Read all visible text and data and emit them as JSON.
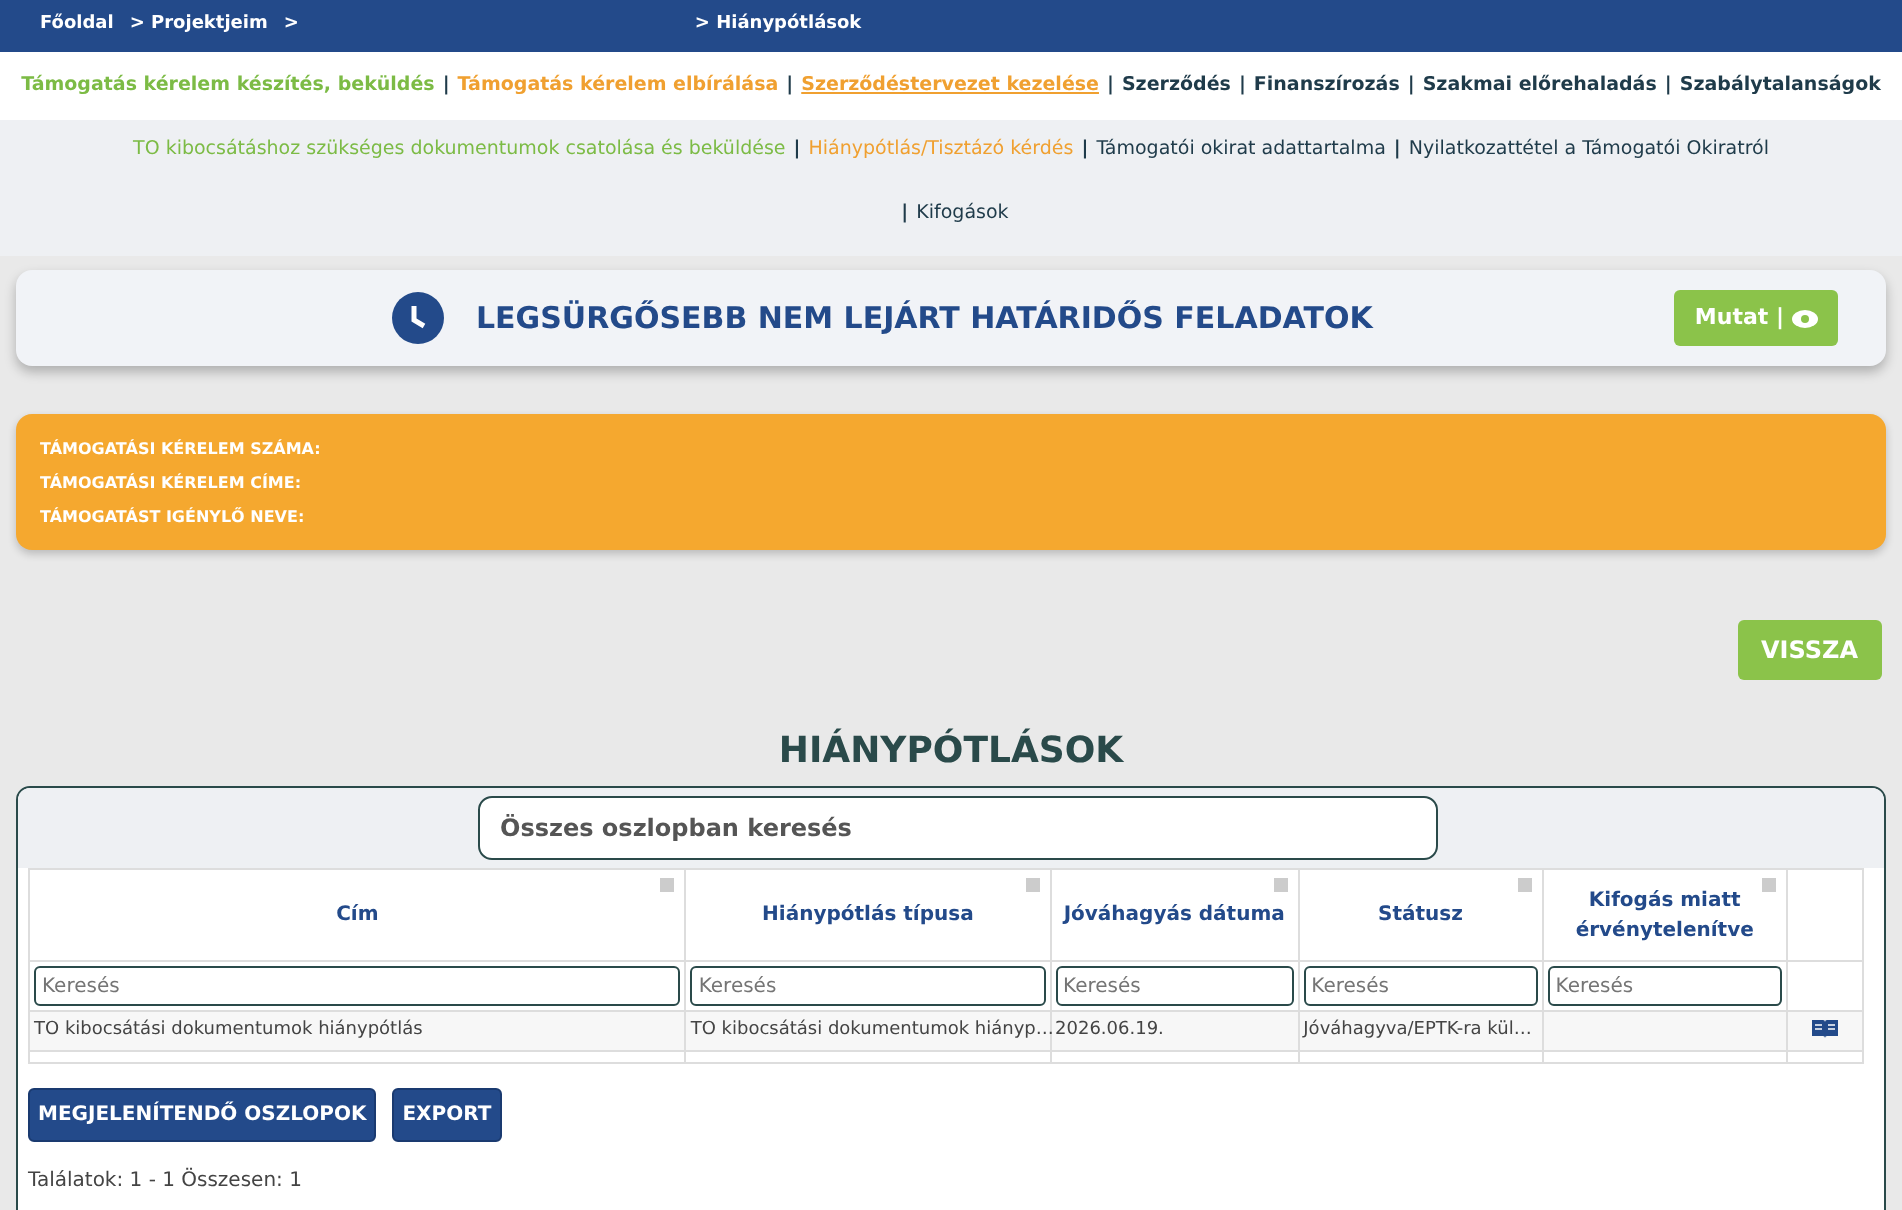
{
  "breadcrumb": [
    {
      "label": "Főoldal"
    },
    {
      "label": "> Projektjeim"
    },
    {
      "label": ">"
    },
    {
      "label": "> Hiánypótlások"
    }
  ],
  "main_nav": [
    {
      "label": "Támogatás kérelem készítés, beküldés",
      "color": "#7cbb45",
      "selected": false
    },
    {
      "separator": "|",
      "label": "Támogatás kérelem elbírálása",
      "color": "#f0a030",
      "selected": false
    },
    {
      "separator": "|",
      "label": "Szerződéstervezet kezelése",
      "color": "#f0a030",
      "selected": true
    },
    {
      "separator": "|",
      "label": "Szerződés",
      "color": "#1f3b4a",
      "selected": false
    },
    {
      "separator": "|",
      "label": "Finanszírozás",
      "color": "#1f3b4a",
      "selected": false
    },
    {
      "separator": "|",
      "label": "Szakmai előrehaladás",
      "color": "#1f3b4a",
      "selected": false
    },
    {
      "separator": "|",
      "label": "Szabálytalanságok",
      "color": "#1f3b4a",
      "selected": false
    }
  ],
  "sub_nav": [
    {
      "label": "TO kibocsátáshoz szükséges dokumentumok csatolása és beküldése",
      "color": "#7cbb45"
    },
    {
      "separator": "|",
      "label": "Hiánypótlás/Tisztázó kérdés",
      "color": "#f0a030"
    },
    {
      "separator": "|",
      "label": "Támogatói okirat adattartalma",
      "color": "#1f3b4a"
    },
    {
      "separator": "|",
      "label": "Nyilatkozattétel a Támogatói Okiratról",
      "color": "#1f3b4a"
    },
    {
      "separator": "|",
      "label": "Kifogások",
      "color": "#1f3b4a"
    }
  ],
  "deadline_panel": {
    "title": "LEGSÜRGŐSEBB NEM LEJÁRT HATÁRIDŐS FELADATOK",
    "button": "Mutat |"
  },
  "application_info": [
    {
      "label": "TÁMOGATÁSI KÉRELEM SZÁMA:"
    },
    {
      "label": "TÁMOGATÁSI KÉRELEM CÍME:"
    },
    {
      "label": "TÁMOGATÁST IGÉNYLŐ NEVE:"
    }
  ],
  "back_button": "VISSZA",
  "section_title": "HIÁNYPÓTLÁSOK",
  "table": {
    "global_search": {
      "placeholder": "Összes oszlopban keresés"
    },
    "columns": [
      {
        "label": "Cím",
        "filter_placeholder": "Keresés"
      },
      {
        "label": "Hiánypótlás típusa",
        "filter_placeholder": "Keresés"
      },
      {
        "label": "Jóváhagyás dátuma",
        "filter_placeholder": "Keresés"
      },
      {
        "label": "Státusz",
        "filter_placeholder": "Keresés"
      },
      {
        "label": "Kifogás miatt érvénytelenítve",
        "filter_placeholder": "Keresés"
      }
    ],
    "rows": [
      {
        "cells": [
          "TO kibocsátási dokumentumok hiánypótlás",
          "TO kibocsátási dokumentumok hiányp…",
          "2026.06.19.",
          "Jóváhagyva/EPTK-ra kül…"
        ]
      }
    ],
    "buttons": [
      "MEGJELENÍTENDŐ OSZLOPOK",
      "EXPORT"
    ],
    "summary": "Találatok: 1 - 1 Összesen: 1"
  }
}
